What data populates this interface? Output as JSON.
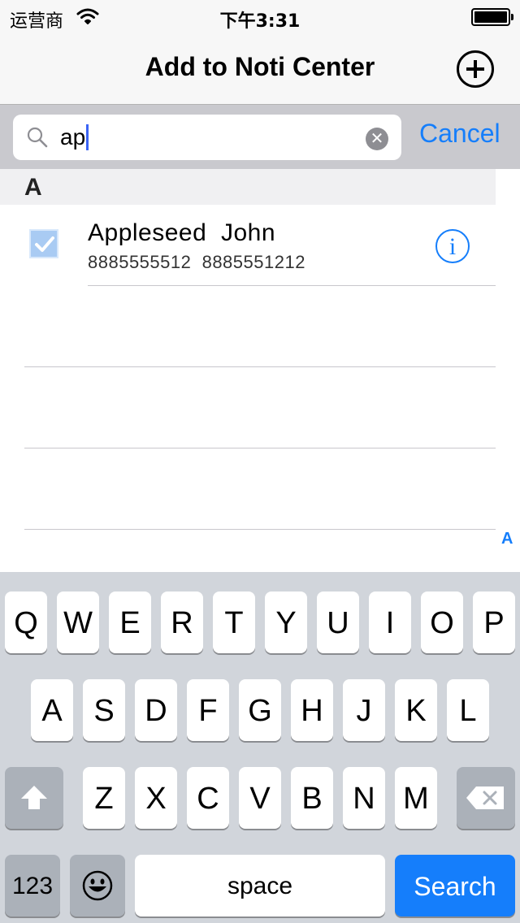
{
  "status_bar": {
    "carrier": "运营商",
    "time": "下午3:31"
  },
  "nav": {
    "title": "Add to Noti Center",
    "add_button": "plus-circle-icon"
  },
  "search": {
    "query": "ap",
    "cancel_label": "Cancel"
  },
  "section": {
    "header": "A"
  },
  "contacts": [
    {
      "name": "Appleseed  John",
      "phones": "8885555512  8885551212",
      "checked": true
    }
  ],
  "index_letters": [
    "A"
  ],
  "keyboard": {
    "row1": [
      "Q",
      "W",
      "E",
      "R",
      "T",
      "Y",
      "U",
      "I",
      "O",
      "P"
    ],
    "row2": [
      "A",
      "S",
      "D",
      "F",
      "G",
      "H",
      "J",
      "K",
      "L"
    ],
    "row3": [
      "Z",
      "X",
      "C",
      "V",
      "B",
      "N",
      "M"
    ],
    "numbers_label": "123",
    "space_label": "space",
    "search_label": "Search"
  },
  "colors": {
    "accent": "#157efb",
    "keyboard_bg": "#d1d5db",
    "searchbar_bg": "#c9c9ce"
  }
}
